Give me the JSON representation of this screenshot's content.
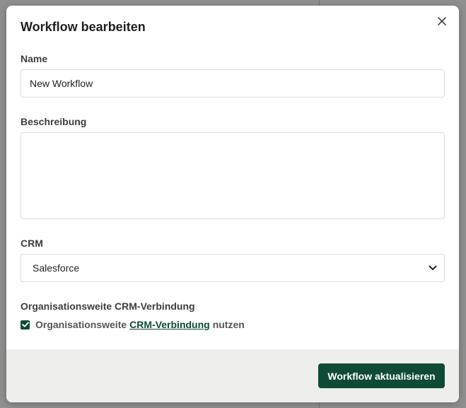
{
  "dialog": {
    "title": "Workflow bearbeiten"
  },
  "fields": {
    "name": {
      "label": "Name",
      "value": "New Workflow"
    },
    "description": {
      "label": "Beschreibung",
      "value": ""
    },
    "crm": {
      "label": "CRM",
      "selected": "Salesforce"
    },
    "org_connection": {
      "label": "Organisationsweite CRM-Verbindung",
      "checked": true,
      "checkbox_text_before": "Organisationsweite",
      "checkbox_link": "CRM-Verbindung",
      "checkbox_text_after": "nutzen"
    }
  },
  "footer": {
    "submit_label": "Workflow aktualisieren"
  },
  "colors": {
    "accent": "#0f4a36",
    "footer_bg": "#eeeeec",
    "overlay": "#8f8f8f"
  },
  "icons": {
    "close": "close-icon",
    "select_arrow": "chevron-down-icon",
    "check": "checkmark-icon"
  }
}
